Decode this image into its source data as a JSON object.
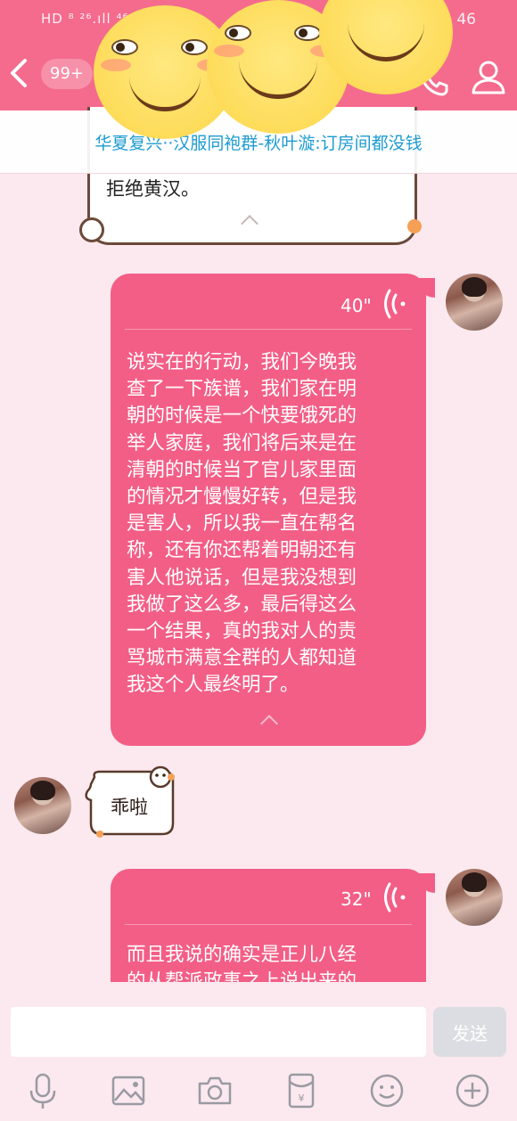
{
  "status_bar": {
    "left": "HD ⁸ ²⁶.ıll ⁴⁶.ıll",
    "right": "46"
  },
  "header": {
    "unread_count": "99+"
  },
  "pinned": {
    "text": "华夏复兴··汉服同袍群-秋叶漩:订房间都没钱"
  },
  "messages": [
    {
      "id": "msg1",
      "text": "拒绝黄汉。"
    },
    {
      "id": "msg2",
      "duration": "40\"",
      "text": "说实在的行动，我们今晚我\n查了一下族谱，我们家在明\n朝的时候是一个快要饿死的\n举人家庭，我们将后来是在\n清朝的时候当了官儿家里面\n的情况才慢慢好转，但是我\n是害人，所以我一直在帮名\n称，还有你还帮着明朝还有\n害人他说话，但是我没想到\n我做了这么多，最后得这么\n一个结果，真的我对人的责\n骂城市满意全群的人都知道\n我这个人最终明了。"
    },
    {
      "id": "msg3",
      "sticker_text": "乖啦"
    },
    {
      "id": "msg4",
      "duration": "32\"",
      "text": "而且我说的确实是正儿八经\n的从帮派政事之上说出来的"
    }
  ],
  "input": {
    "placeholder": "",
    "send_label": "发送"
  },
  "toolbar_icons": [
    "microphone-icon",
    "image-icon",
    "camera-icon",
    "red-packet-icon",
    "emoji-icon",
    "plus-icon"
  ],
  "colors": {
    "accent": "#f46b8d",
    "bubble": "#f35e86",
    "link": "#1d9bd1"
  }
}
